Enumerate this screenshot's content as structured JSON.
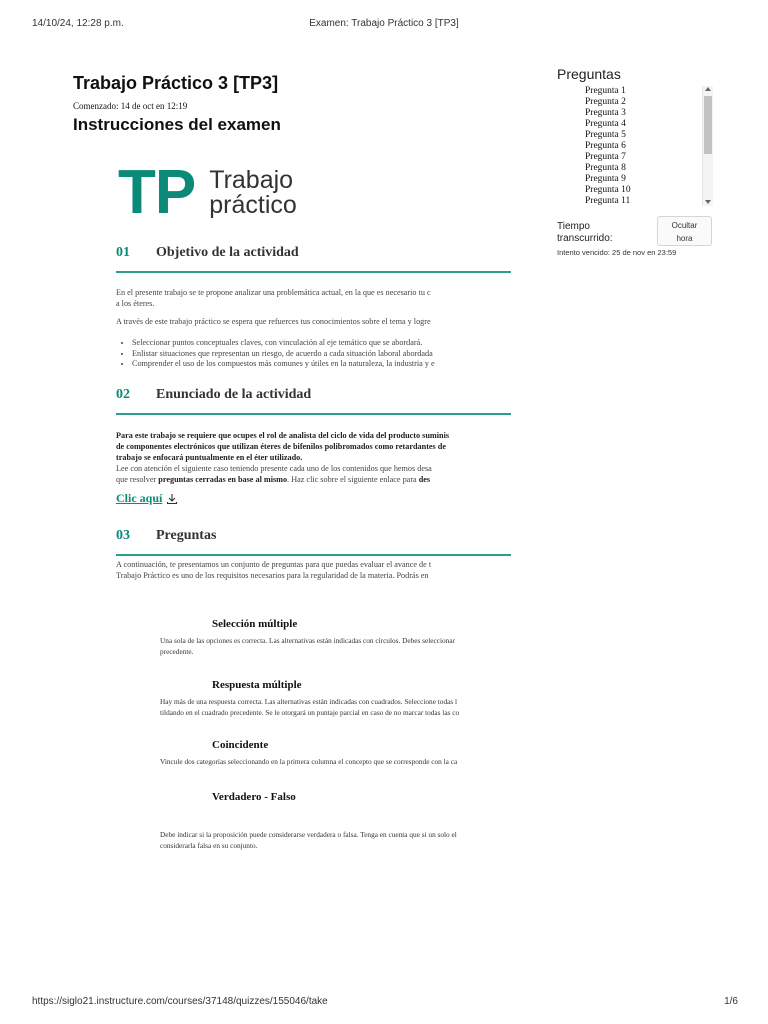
{
  "print": {
    "datetime": "14/10/24, 12:28 p.m.",
    "page_title": "Examen: Trabajo Práctico 3 [TP3]",
    "url": "https://siglo21.instructure.com/courses/37148/quizzes/155046/take",
    "page_number": "1/6"
  },
  "quiz": {
    "title": "Trabajo Práctico 3 [TP3]",
    "started": "Comenzado: 14 de oct en 12:19",
    "instructions_heading": "Instrucciones del examen"
  },
  "logo": {
    "letters": "TP",
    "word1": "Trabajo",
    "word2": "práctico"
  },
  "sections": [
    {
      "number": "01",
      "title": "Objetivo de la actividad",
      "paragraphs": [
        "En el presente trabajo se te propone analizar una problemática actual, en la que es necesario tu c",
        "a los éteres.",
        "A través de este trabajo práctico se espera que refuerces tus conocimientos sobre el tema y logre"
      ],
      "bullets": [
        "Seleccionar puntos conceptuales claves, con vinculación al eje temático que se abordará.",
        "Enlistar situaciones que representan un riesgo, de acuerdo a cada situación laboral abordada",
        "Comprender el uso de los compuestos más comunes y útiles en la naturaleza, la industria y e"
      ]
    },
    {
      "number": "02",
      "title": "Enunciado de la actividad",
      "bold_lines": [
        "Para este trabajo se requiere que ocupes el rol de analista del ciclo de vida del producto suminis",
        "de componentes electrónicos que utilizan éteres de bifenilos polibromados como retardantes de",
        "trabajo se enfocará puntualmente en el éter utilizado."
      ],
      "line4": "Lee con atención el siguiente caso teniendo presente cada uno de los contenidos que hemos desa",
      "line5_a": "que resolver ",
      "line5_bold": "preguntas cerradas en base al mismo",
      "line5_b": ". Haz clic sobre el siguiente enlace para ",
      "line5_bold2": "des",
      "link": "Clic aquí"
    },
    {
      "number": "03",
      "title": "Preguntas",
      "paragraphs": [
        "A continuación, te presentamos un conjunto de preguntas para que puedas evaluar el avance de t",
        "Trabajo Práctico es uno de los requisitos necesarios para la regularidad de la materia. Podrás en"
      ]
    }
  ],
  "question_types": [
    {
      "title": "Selección múltiple",
      "desc": [
        "Una sola de las opciones es correcta. Las alternativas están indicadas con círculos. Debes seleccionar",
        "precedente."
      ]
    },
    {
      "title": "Respuesta múltiple",
      "desc": [
        "Hay más de una respuesta correcta. Las alternativas están indicadas con cuadrados. Seleccione todas l",
        "tildando en el cuadrado precedente. Se le otorgará un puntaje parcial en caso de no marcar todas las co"
      ]
    },
    {
      "title": "Coincidente",
      "desc": [
        "Vincule dos categorías seleccionando en la primera columna el concepto que se corresponde con la ca"
      ]
    },
    {
      "title": "Verdadero - Falso",
      "desc": [
        "Debe indicar si la proposición puede considerarse verdadera o falsa. Tenga en cuenta que si un solo el",
        "considerarla falsa en su conjunto."
      ]
    }
  ],
  "sidebar": {
    "title": "Preguntas",
    "questions": [
      "Pregunta 1",
      "Pregunta 2",
      "Pregunta 3",
      "Pregunta 4",
      "Pregunta 5",
      "Pregunta 6",
      "Pregunta 7",
      "Pregunta 8",
      "Pregunta 9",
      "Pregunta 10",
      "Pregunta 11"
    ],
    "time_label": "Tiempo transcurrido:",
    "hide_time_line1": "Ocultar",
    "hide_time_line2": "hora",
    "expired": "Intento vencido: 25 de nov en 23:59"
  },
  "colors": {
    "accent": "#0c8a78",
    "rule": "#2c9e8c"
  }
}
